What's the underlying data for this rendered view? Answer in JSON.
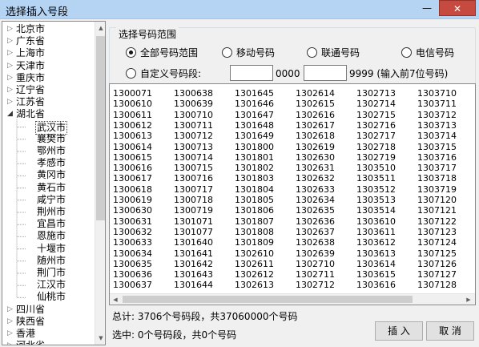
{
  "window": {
    "title": "选择插入号段",
    "min_glyph": "—",
    "close_glyph": "✕"
  },
  "tree": {
    "collapsed_glyph": "▷",
    "expanded_glyph": "◢",
    "items": [
      {
        "label": "北京市",
        "level": 0,
        "state": "collapsed"
      },
      {
        "label": "广东省",
        "level": 0,
        "state": "collapsed"
      },
      {
        "label": "上海市",
        "level": 0,
        "state": "collapsed"
      },
      {
        "label": "天津市",
        "level": 0,
        "state": "collapsed"
      },
      {
        "label": "重庆市",
        "level": 0,
        "state": "collapsed"
      },
      {
        "label": "辽宁省",
        "level": 0,
        "state": "collapsed"
      },
      {
        "label": "江苏省",
        "level": 0,
        "state": "collapsed"
      },
      {
        "label": "湖北省",
        "level": 0,
        "state": "expanded"
      },
      {
        "label": "武汉市",
        "level": 1,
        "state": "selected"
      },
      {
        "label": "襄樊市",
        "level": 1,
        "state": "leaf"
      },
      {
        "label": "鄂州市",
        "level": 1,
        "state": "leaf"
      },
      {
        "label": "孝感市",
        "level": 1,
        "state": "leaf"
      },
      {
        "label": "黄冈市",
        "level": 1,
        "state": "leaf"
      },
      {
        "label": "黄石市",
        "level": 1,
        "state": "leaf"
      },
      {
        "label": "咸宁市",
        "level": 1,
        "state": "leaf"
      },
      {
        "label": "荆州市",
        "level": 1,
        "state": "leaf"
      },
      {
        "label": "宜昌市",
        "level": 1,
        "state": "leaf"
      },
      {
        "label": "恩施市",
        "level": 1,
        "state": "leaf"
      },
      {
        "label": "十堰市",
        "level": 1,
        "state": "leaf"
      },
      {
        "label": "随州市",
        "level": 1,
        "state": "leaf"
      },
      {
        "label": "荆门市",
        "level": 1,
        "state": "leaf"
      },
      {
        "label": "江汉市",
        "level": 1,
        "state": "leaf"
      },
      {
        "label": "仙桃市",
        "level": 1,
        "state": "leaf"
      },
      {
        "label": "四川省",
        "level": 0,
        "state": "collapsed"
      },
      {
        "label": "陕西省",
        "level": 0,
        "state": "collapsed"
      },
      {
        "label": "香港",
        "level": 0,
        "state": "collapsed"
      },
      {
        "label": "河北省",
        "level": 0,
        "state": "collapsed"
      }
    ]
  },
  "range_group": {
    "title": "选择号码范围",
    "options": [
      {
        "label": "全部号码范围",
        "selected": true
      },
      {
        "label": "移动号码",
        "selected": false
      },
      {
        "label": "联通号码",
        "selected": false
      },
      {
        "label": "电信号码",
        "selected": false
      }
    ],
    "custom": {
      "label": "自定义号码段:",
      "selected": false,
      "start_value": "",
      "start_suffix": "0000 -",
      "end_value": "",
      "end_suffix": "9999 (输入前7位号码)"
    }
  },
  "number_columns": [
    [
      "1300071",
      "1300610",
      "1300611",
      "1300612",
      "1300613",
      "1300614",
      "1300615",
      "1300616",
      "1300617",
      "1300618",
      "1300619",
      "1300630",
      "1300631",
      "1300632",
      "1300633",
      "1300634",
      "1300635",
      "1300636",
      "1300637"
    ],
    [
      "1300638",
      "1300639",
      "1300710",
      "1300711",
      "1300712",
      "1300713",
      "1300714",
      "1300715",
      "1300716",
      "1300717",
      "1300718",
      "1300719",
      "1301071",
      "1301077",
      "1301640",
      "1301641",
      "1301642",
      "1301643",
      "1301644"
    ],
    [
      "1301645",
      "1301646",
      "1301647",
      "1301648",
      "1301649",
      "1301800",
      "1301801",
      "1301802",
      "1301803",
      "1301804",
      "1301805",
      "1301806",
      "1301807",
      "1301808",
      "1301809",
      "1302610",
      "1302611",
      "1302612",
      "1302613"
    ],
    [
      "1302614",
      "1302615",
      "1302616",
      "1302617",
      "1302618",
      "1302619",
      "1302630",
      "1302631",
      "1302632",
      "1302633",
      "1302634",
      "1302635",
      "1302636",
      "1302637",
      "1302638",
      "1302639",
      "1302710",
      "1302711",
      "1302712"
    ],
    [
      "1302713",
      "1302714",
      "1302715",
      "1302716",
      "1302717",
      "1302718",
      "1302719",
      "1303510",
      "1303511",
      "1303512",
      "1303513",
      "1303514",
      "1303610",
      "1303611",
      "1303612",
      "1303613",
      "1303614",
      "1303615",
      "1303616"
    ],
    [
      "1303710",
      "1303711",
      "1303712",
      "1303713",
      "1303714",
      "1303715",
      "1303716",
      "1303717",
      "1303718",
      "1303719",
      "1307120",
      "1307121",
      "1307122",
      "1307123",
      "1307124",
      "1307125",
      "1307126",
      "1307127",
      "1307128"
    ]
  ],
  "status": {
    "total": "总计: 3706个号码段，共37060000个号码",
    "selected": "选中: 0个号码段，共0个号码"
  },
  "buttons": {
    "insert": "插 入",
    "cancel": "取 消"
  },
  "scroll_glyphs": {
    "up": "▲",
    "down": "▼",
    "left": "◀",
    "right": "▶"
  }
}
